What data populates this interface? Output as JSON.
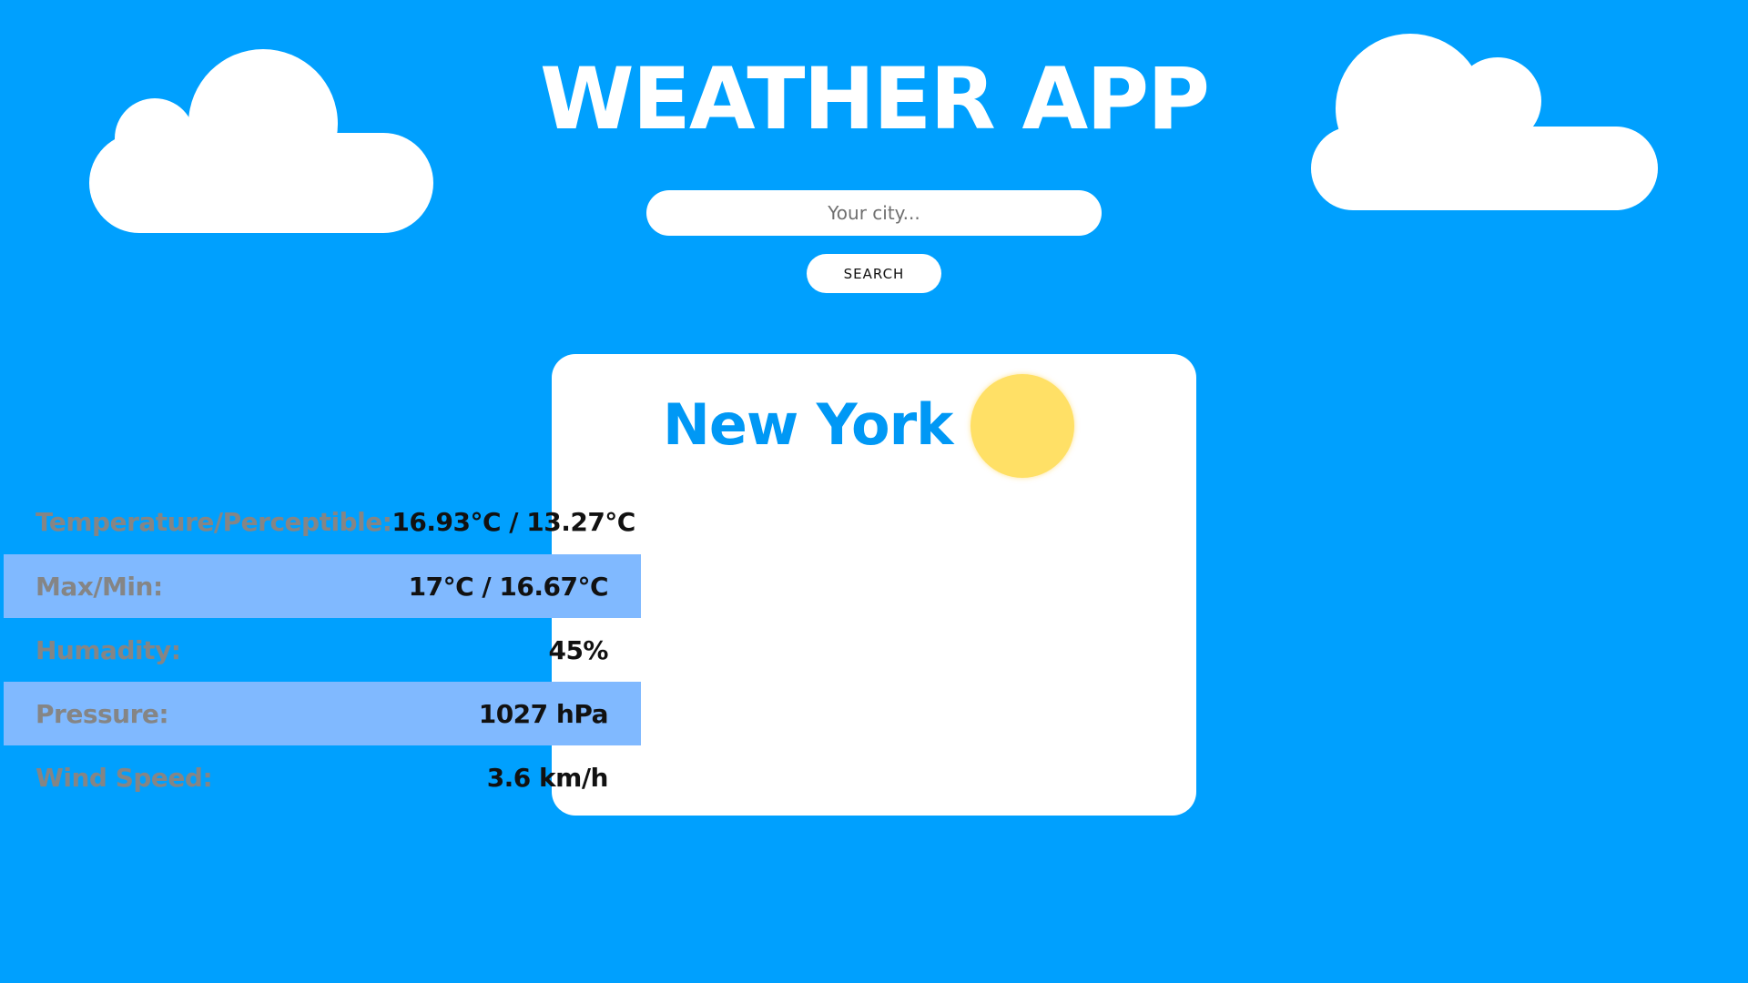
{
  "header": {
    "title": "WEATHER APP"
  },
  "search": {
    "placeholder": "Your city...",
    "value": "",
    "button_label": "SEARCH"
  },
  "card": {
    "city": "New York",
    "weather_icon": "sun-icon",
    "rows": [
      {
        "label": "Temperature/Perceptible:",
        "value": "16.93°C / 13.27°C"
      },
      {
        "label": "Max/Min:",
        "value": "17°C / 16.67°C"
      },
      {
        "label": "Humadity:",
        "value": "45%"
      },
      {
        "label": "Pressure:",
        "value": "1027 hPa"
      },
      {
        "label": "Wind Speed:",
        "value": "3.6 km/h"
      }
    ]
  },
  "colors": {
    "background": "#00a0fe",
    "city_text": "#0098f5",
    "alt_row": "#80b9ff",
    "sun": "#ffe066"
  }
}
